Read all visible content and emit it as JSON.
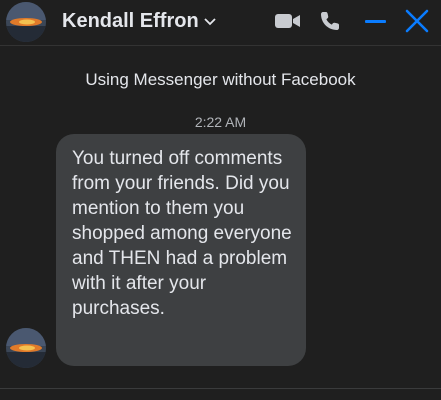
{
  "header": {
    "contact_name": "Kendall Effron",
    "icons": [
      "video-call-icon",
      "voice-call-icon",
      "minimize-icon",
      "close-icon"
    ],
    "accent_color": "#0a7cff"
  },
  "conversation": {
    "notice": "Using Messenger without Facebook",
    "timestamp": "2:22 AM",
    "message": "You turned off comments from your friends. Did you mention to them you shopped among everyone and THEN had a problem with it after your purchases."
  }
}
